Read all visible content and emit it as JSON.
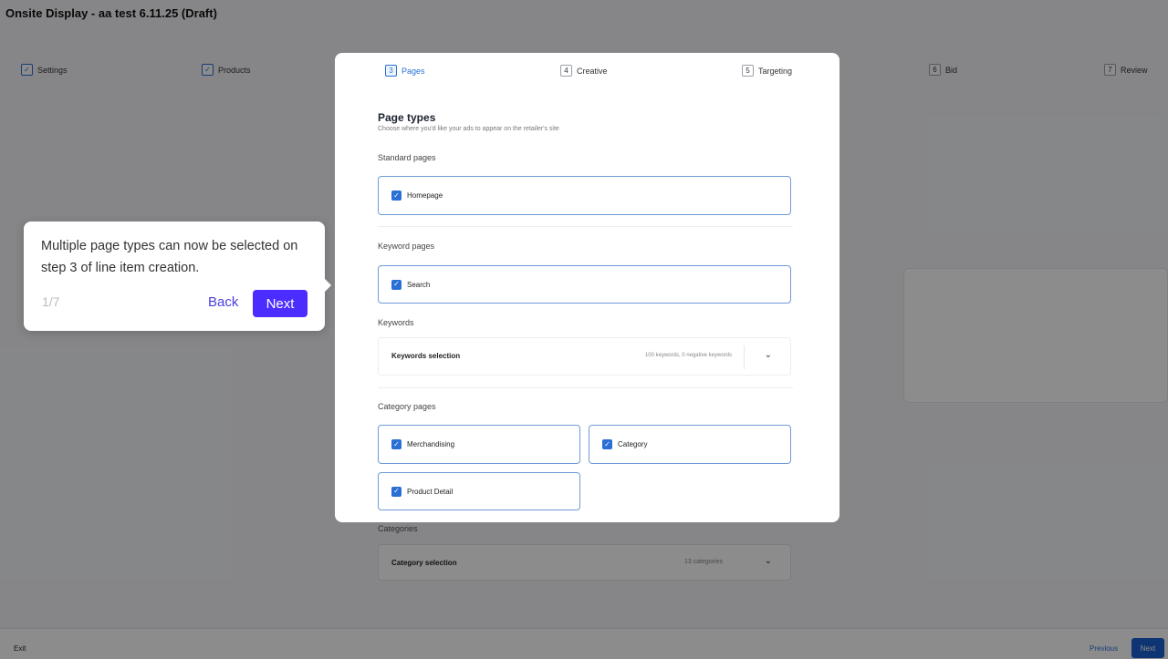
{
  "app": {
    "title": "Onsite Display - aa test 6.11.25 (Draft)"
  },
  "stepper": {
    "settings": {
      "label": "Settings"
    },
    "products": {
      "label": "Products"
    },
    "pages": {
      "num": "3",
      "label": "Pages"
    },
    "creative": {
      "num": "4",
      "label": "Creative"
    },
    "targeting": {
      "num": "5",
      "label": "Targeting"
    },
    "bid": {
      "num": "6",
      "label": "Bid"
    },
    "review": {
      "num": "7",
      "label": "Review"
    }
  },
  "page_types": {
    "title": "Page types",
    "subtitle": "Choose where you'd like your ads to appear on the retailer's site",
    "standard_label": "Standard pages",
    "homepage": "Homepage",
    "keyword_pages_label": "Keyword pages",
    "search": "Search",
    "keywords_label": "Keywords",
    "keywords_selection": "Keywords selection",
    "keywords_meta": "100 keywords, 0 negative keywords",
    "category_pages_label": "Category pages",
    "merchandising": "Merchandising",
    "category": "Category",
    "product_detail": "Product Detail"
  },
  "background": {
    "categories_label": "Categories",
    "category_selection": "Category selection",
    "category_meta": "13 categories"
  },
  "footer": {
    "exit": "Exit",
    "previous": "Previous",
    "next": "Next"
  },
  "tooltip": {
    "text": "Multiple page types can now be selected on step 3 of line item creation.",
    "count": "1/7",
    "back": "Back",
    "next": "Next"
  },
  "colors": {
    "accent": "#2a6fd4",
    "tooltip_button": "#4c2dff"
  },
  "icons": {
    "checkbox": "check-icon",
    "dropdown": "chevron-down-icon"
  }
}
